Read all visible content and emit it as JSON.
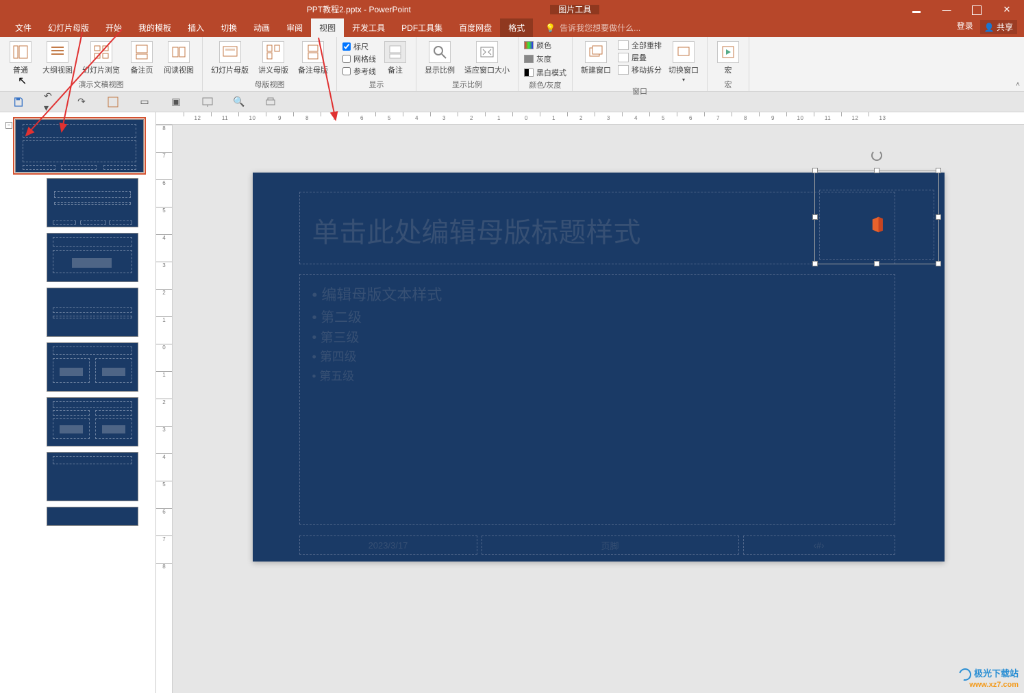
{
  "title": {
    "doc": "PPT教程2.pptx - PowerPoint",
    "context_tab": "图片工具",
    "login": "登录",
    "share": "共享"
  },
  "tabs": {
    "file": "文件",
    "slidemaster": "幻灯片母版",
    "home": "开始",
    "mytemplate": "我的模板",
    "insert": "插入",
    "transition": "切换",
    "animation": "动画",
    "review": "审阅",
    "view": "视图",
    "dev": "开发工具",
    "pdf": "PDF工具集",
    "baidu": "百度网盘",
    "format": "格式",
    "tellme": "告诉我您想要做什么..."
  },
  "ribbon": {
    "normal": "普通",
    "outline": "大纲视图",
    "sorter": "幻灯片浏览",
    "notes_page": "备注页",
    "reading": "阅读视图",
    "presentation_views": "演示文稿视图",
    "slide_master": "幻灯片母版",
    "handout_master": "讲义母版",
    "notes_master": "备注母版",
    "master_views": "母版视图",
    "ruler": "标尺",
    "gridlines": "网格线",
    "guides": "参考线",
    "notes_btn": "备注",
    "show": "显示",
    "zoom": "显示比例",
    "fit": "适应窗口大小",
    "zoom_group": "显示比例",
    "color": "颜色",
    "gray": "灰度",
    "bw": "黑白模式",
    "color_group": "颜色/灰度",
    "new_window": "新建窗口",
    "arrange_all": "全部重排",
    "cascade": "层叠",
    "move_split": "移动拆分",
    "switch": "切换窗口",
    "window_group": "窗口",
    "macros": "宏",
    "macros_group": "宏"
  },
  "slide": {
    "title_ph": "单击此处编辑母版标题样式",
    "body_l1": "编辑母版文本样式",
    "body_l2": "第二级",
    "body_l3": "第三级",
    "body_l4": "第四级",
    "body_l5": "第五级",
    "date": "2023/3/17",
    "footer": "页脚",
    "num": "‹#›"
  },
  "thumbs": {
    "collapse": "−"
  },
  "ruler_ticks": [
    "12",
    "11",
    "10",
    "9",
    "8",
    "7",
    "6",
    "5",
    "4",
    "3",
    "2",
    "1",
    "0",
    "1",
    "2",
    "3",
    "4",
    "5",
    "6",
    "7",
    "8",
    "9",
    "10",
    "11",
    "12",
    "13"
  ],
  "ruler_v": [
    "8",
    "7",
    "6",
    "5",
    "4",
    "3",
    "2",
    "1",
    "0",
    "1",
    "2",
    "3",
    "4",
    "5",
    "6",
    "7",
    "8"
  ],
  "watermark": {
    "line1": "极光下载站",
    "line2": "www.xz7.com"
  }
}
